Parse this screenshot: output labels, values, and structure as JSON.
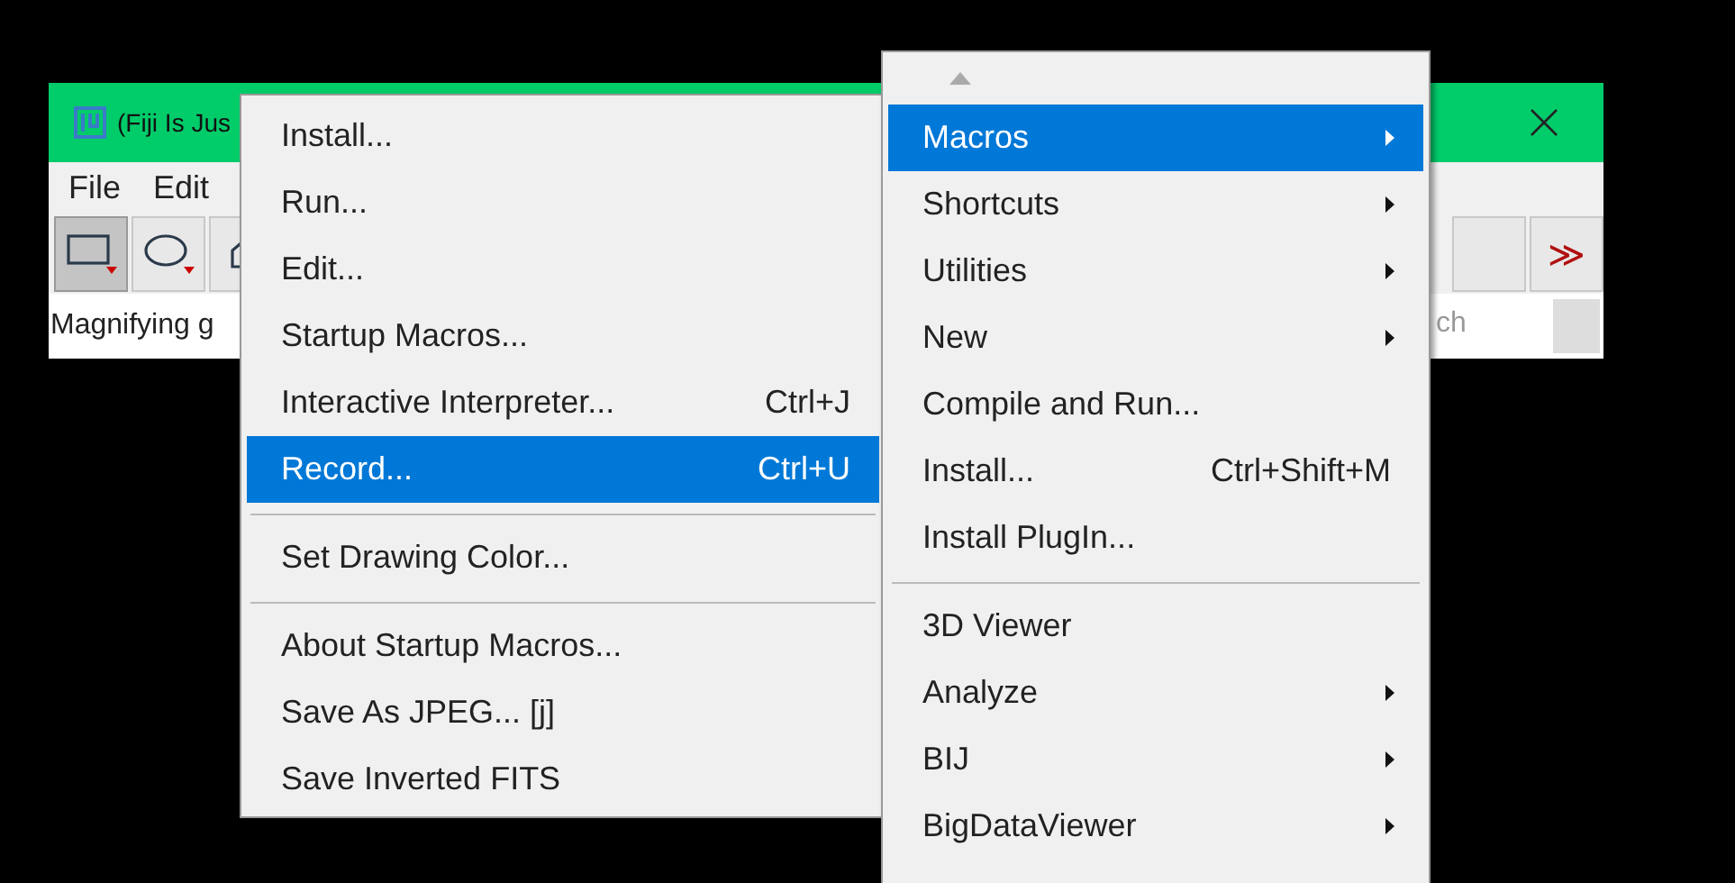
{
  "window": {
    "title": "(Fiji Is Jus",
    "menus": [
      {
        "label": "File"
      },
      {
        "label": "Edit"
      }
    ],
    "tools": [
      {
        "kind": "rectangle",
        "selected": true
      },
      {
        "kind": "oval",
        "selected": false
      },
      {
        "kind": "polygon",
        "selected": false
      }
    ],
    "more_tools": "≫",
    "status": "Magnifying g",
    "search": {
      "value": "ch"
    }
  },
  "macros_menu": {
    "items": [
      {
        "kind": "item",
        "label": "Install...",
        "selected": false
      },
      {
        "kind": "item",
        "label": "Run...",
        "selected": false
      },
      {
        "kind": "item",
        "label": "Edit...",
        "selected": false
      },
      {
        "kind": "item",
        "label": "Startup Macros...",
        "selected": false
      },
      {
        "kind": "item",
        "label": "Interactive Interpreter...",
        "shortcut": "Ctrl+J",
        "selected": false
      },
      {
        "kind": "item",
        "label": "Record...",
        "shortcut": "Ctrl+U",
        "selected": true
      },
      {
        "kind": "separator"
      },
      {
        "kind": "item",
        "label": "Set Drawing Color...",
        "selected": false
      },
      {
        "kind": "separator"
      },
      {
        "kind": "item",
        "label": "About Startup Macros...",
        "selected": false
      },
      {
        "kind": "item",
        "label": "Save As JPEG... [j]",
        "selected": false
      },
      {
        "kind": "item",
        "label": "Save Inverted FITS",
        "selected": false
      }
    ]
  },
  "plugins_menu": {
    "items": [
      {
        "kind": "item",
        "label": "Macros",
        "submenu": true,
        "selected": true
      },
      {
        "kind": "item",
        "label": "Shortcuts",
        "submenu": true,
        "selected": false
      },
      {
        "kind": "item",
        "label": "Utilities",
        "submenu": true,
        "selected": false
      },
      {
        "kind": "item",
        "label": "New",
        "submenu": true,
        "selected": false
      },
      {
        "kind": "item",
        "label": "Compile and Run...",
        "submenu": false,
        "selected": false
      },
      {
        "kind": "item",
        "label": "Install...",
        "shortcut": "Ctrl+Shift+M",
        "submenu": false,
        "selected": false
      },
      {
        "kind": "item",
        "label": "Install PlugIn...",
        "submenu": false,
        "selected": false
      },
      {
        "kind": "separator"
      },
      {
        "kind": "item",
        "label": "3D Viewer",
        "submenu": false,
        "selected": false
      },
      {
        "kind": "item",
        "label": "Analyze",
        "submenu": true,
        "selected": false
      },
      {
        "kind": "item",
        "label": "BIJ",
        "submenu": true,
        "selected": false
      },
      {
        "kind": "item",
        "label": "BigDataViewer",
        "submenu": true,
        "selected": false
      }
    ]
  }
}
